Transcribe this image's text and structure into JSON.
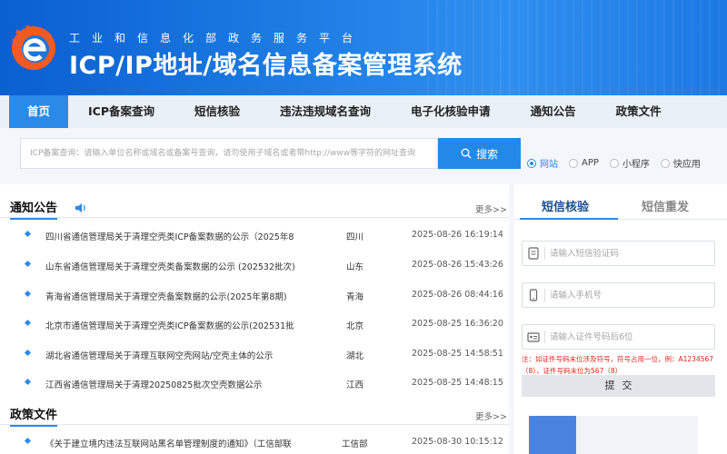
{
  "header": {
    "subtitle": "工业和信息化部政务服务平台",
    "title": "ICP/IP地址/域名信息备案管理系统"
  },
  "nav": {
    "items": [
      "首页",
      "ICP备案查询",
      "短信核验",
      "违法违规域名查询",
      "电子化核验申请",
      "通知公告",
      "政策文件"
    ],
    "active_index": 0
  },
  "search": {
    "placeholder": "ICP备案查询：请输入单位名称或域名或备案号查询，请勿使用子域名或者带http://www等字符的网址查询",
    "button_label": "搜索",
    "options": [
      "网站",
      "APP",
      "小程序",
      "快应用"
    ],
    "selected": "网站"
  },
  "notices": {
    "title": "通知公告",
    "more": "更多>>",
    "rows": [
      {
        "title": "四川省通信管理局关于清理空壳类ICP备案数据的公示（2025年8",
        "province": "四川",
        "date": "2025-08-26 16:19:14"
      },
      {
        "title": "山东省通信管理局关于清理空壳类备案数据的公示 (202532批次)",
        "province": "山东",
        "date": "2025-08-26 15:43:26"
      },
      {
        "title": "青海省通信管理局关于清理空壳备案数据的公示(2025年第8期)",
        "province": "青海",
        "date": "2025-08-26 08:44:16"
      },
      {
        "title": "北京市通信管理局关于清理空壳类ICP备案数据的公示(202531批",
        "province": "北京",
        "date": "2025-08-25 16:36:20"
      },
      {
        "title": "湖北省通信管理局关于清理互联网空壳网站/空壳主体的公示",
        "province": "湖北",
        "date": "2025-08-25 14:58:51"
      },
      {
        "title": "江西省通信管理局关于清理20250825批次空壳数据公示",
        "province": "江西",
        "date": "2025-08-25 14:48:15"
      }
    ]
  },
  "policies": {
    "title": "政策文件",
    "more": "更多>>",
    "rows": [
      {
        "title": "《关于建立境内违法互联网站黑名单管理制度的通知》（工信部联",
        "province": "工信部",
        "date": "2025-08-30 10:15:12"
      }
    ]
  },
  "sms": {
    "tab_active": "短信核验",
    "tab_inactive": "短信重发",
    "code_placeholder": "请输入短信验证码",
    "phone_placeholder": "请输入手机号",
    "id_placeholder": "请输入证件号码后6位",
    "hint": "注：如证件号码末位涉及符号，符号占用一位，例：A1234567（8），证件号码末位为567（8）",
    "submit_label": "提交"
  },
  "colors": {
    "primary": "#2b8ae8",
    "header_dark": "#0a5fd1",
    "hint_red": "#e0241a",
    "logo_orange": "#f15a22"
  }
}
